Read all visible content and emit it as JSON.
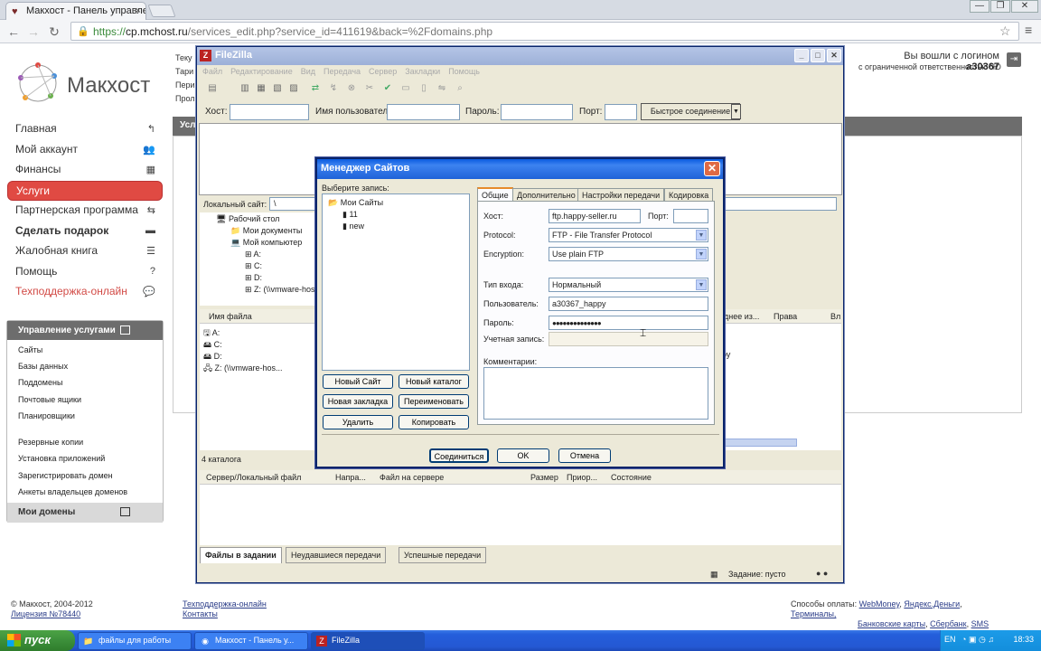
{
  "browser": {
    "tab_title": "Макхост - Панель управлен",
    "url_scheme": "https://",
    "url_host": "cp.mchost.ru",
    "url_path": "/services_edit.php?service_id=411619&back=%2Fdomains.php",
    "window_min": "—",
    "window_max": "❐",
    "window_close": "✕"
  },
  "site": {
    "logo_text": "Макхост",
    "top_info": [
      "Теку",
      "Тари",
      "Пери",
      "Прол"
    ],
    "login_prefix": "Вы вошли с логином",
    "login_name": "a30367",
    "login_org": "с ограниченной ответственностью \"Юри...",
    "menu": [
      {
        "label": "Главная",
        "icon": "↰"
      },
      {
        "label": "Мой аккаунт",
        "icon": "👥"
      },
      {
        "label": "Финансы",
        "icon": "▦"
      },
      {
        "label": "Услуги",
        "icon": ""
      },
      {
        "label": "Партнерская программа",
        "icon": "⇆"
      },
      {
        "label": "Сделать подарок",
        "icon": "▬"
      },
      {
        "label": "Жалобная книга",
        "icon": "☰"
      },
      {
        "label": "Помощь",
        "icon": "?"
      },
      {
        "label": "Техподдержка-онлайн",
        "icon": "💬"
      }
    ],
    "services_title": "Управление услугами",
    "services_items": [
      "Сайты",
      "Базы данных",
      "Поддомены",
      "Почтовые ящики",
      "Планировщики"
    ],
    "services_items2": [
      "Резервные копии",
      "Установка приложений",
      "Зарегистрировать домен",
      "Анкеты владельцев доменов"
    ],
    "my_domains": "Мои домены",
    "content_bar": "Усл",
    "footer_copy": "© Макхост, 2004-2012",
    "footer_license": "Лицензия №78440",
    "footer_support": "Техподдержка-онлайн",
    "footer_contacts": "Контакты",
    "payment_label": "Способы оплаты:",
    "payment_line1": [
      "WebMoney",
      "Яндекс.Деньги",
      "Терминалы,"
    ],
    "payment_line2": [
      "Банковские карты",
      "Сбербанк",
      "SMS"
    ]
  },
  "filezilla": {
    "title": "FileZilla",
    "menu": [
      "Файл",
      "Редактирование",
      "Вид",
      "Передача",
      "Сервер",
      "Закладки",
      "Помощь"
    ],
    "host_label": "Хост:",
    "user_label": "Имя пользователя",
    "pass_label": "Пароль:",
    "port_label": "Порт:",
    "quick_connect": "Быстрое соединение",
    "local_site_label": "Локальный сайт:",
    "local_path": "\\",
    "tree": [
      "Рабочий стол",
      "Мои документы",
      "Мой компьютер",
      "A:",
      "C:",
      "D:",
      "Z: (\\\\vmware-hos..."
    ],
    "file_col_name": "Имя файла",
    "file_col_modified": "днее из...",
    "file_col_rights": "Права",
    "file_col_owner": "Вл",
    "files": [
      "A:",
      "C:",
      "D:",
      "Z: (\\\\vmware-hos..."
    ],
    "remote_partial": "ру",
    "local_status": "4 каталога",
    "queue_cols": [
      "Сервер/Локальный файл",
      "Напра...",
      "Файл на сервере",
      "Размер",
      "Приор...",
      "Состояние"
    ],
    "queue_tabs": [
      "Файлы в задании",
      "Неудавшиеся передачи",
      "Успешные передачи"
    ],
    "status": "Задание: пусто"
  },
  "site_manager": {
    "title": "Менеджер Сайтов",
    "choose_label": "Выберите запись:",
    "root": "Мои Сайты",
    "sites": [
      "11",
      "new"
    ],
    "btn_new_site": "Новый Сайт",
    "btn_new_folder": "Новый каталог",
    "btn_new_bookmark": "Новая закладка",
    "btn_rename": "Переименовать",
    "btn_delete": "Удалить",
    "btn_copy": "Копировать",
    "tabs": [
      "Общие",
      "Дополнительно",
      "Настройки передачи",
      "Кодировка"
    ],
    "host_label": "Хост:",
    "host_value": "ftp.happy-seller.ru",
    "port_label": "Порт:",
    "port_value": "",
    "protocol_label": "Protocol:",
    "protocol_value": "FTP - File Transfer Protocol",
    "encryption_label": "Encryption:",
    "encryption_value": "Use plain FTP",
    "logon_label": "Тип входа:",
    "logon_value": "Нормальный",
    "user_label": "Пользователь:",
    "user_value": "a30367_happy",
    "password_label": "Пароль:",
    "password_value": "●●●●●●●●●●●●●●",
    "account_label": "Учетная запись:",
    "comments_label": "Комментарии:",
    "btn_connect": "Соединиться",
    "btn_ok": "OK",
    "btn_cancel": "Отмена"
  },
  "taskbar": {
    "start": "пуск",
    "items": [
      "файлы для работы",
      "Макхост - Панель у...",
      "FileZilla"
    ],
    "lang": "EN",
    "time": "18:33"
  }
}
